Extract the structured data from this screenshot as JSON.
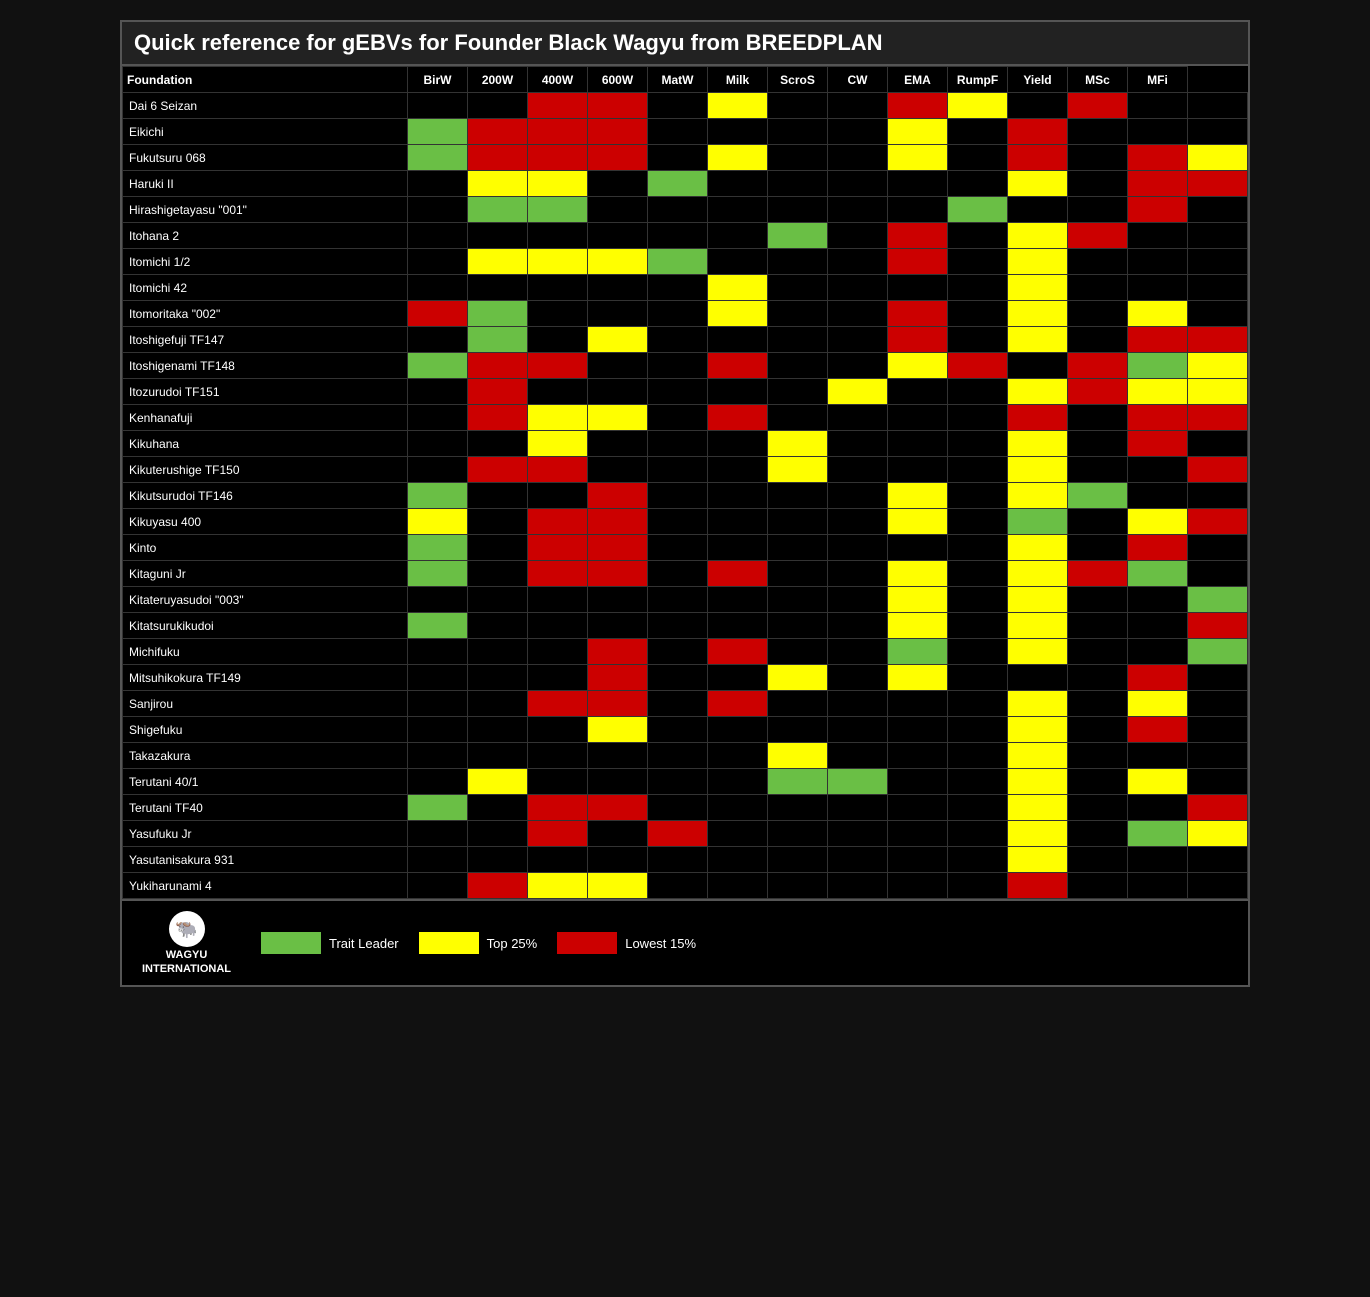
{
  "title": "Quick reference for gEBVs for Founder Black Wagyu from BREEDPLAN",
  "columns": [
    "Foundation",
    "BirW",
    "200W",
    "400W",
    "600W",
    "MatW",
    "Milk",
    "ScroS",
    "CW",
    "EMA",
    "RumpF",
    "Yield",
    "MSc",
    "MFi"
  ],
  "rows": [
    {
      "name": "Dai 6 Seizan",
      "cells": [
        "B",
        "B",
        "R",
        "R",
        "B",
        "Y",
        "B",
        "B",
        "R",
        "Y",
        "B",
        "R",
        "B",
        "B"
      ]
    },
    {
      "name": "Eikichi",
      "cells": [
        "G",
        "R",
        "R",
        "R",
        "B",
        "B",
        "B",
        "B",
        "Y",
        "B",
        "R",
        "B",
        "B",
        "B"
      ]
    },
    {
      "name": "Fukutsuru 068",
      "cells": [
        "G",
        "R",
        "R",
        "R",
        "B",
        "Y",
        "B",
        "B",
        "Y",
        "B",
        "R",
        "B",
        "R",
        "Y"
      ]
    },
    {
      "name": "Haruki II",
      "cells": [
        "B",
        "Y",
        "Y",
        "B",
        "G",
        "B",
        "B",
        "B",
        "B",
        "B",
        "Y",
        "B",
        "R",
        "R"
      ]
    },
    {
      "name": "Hirashigetayasu \"001\"",
      "cells": [
        "B",
        "G",
        "G",
        "B",
        "B",
        "B",
        "B",
        "B",
        "B",
        "G",
        "B",
        "B",
        "R",
        "B"
      ]
    },
    {
      "name": "Itohana 2",
      "cells": [
        "B",
        "B",
        "B",
        "B",
        "B",
        "B",
        "G",
        "B",
        "R",
        "B",
        "Y",
        "R",
        "B",
        "B"
      ]
    },
    {
      "name": "Itomichi 1/2",
      "cells": [
        "B",
        "Y",
        "Y",
        "Y",
        "G",
        "B",
        "B",
        "B",
        "R",
        "B",
        "Y",
        "B",
        "B",
        "B"
      ]
    },
    {
      "name": "Itomichi 42",
      "cells": [
        "B",
        "B",
        "B",
        "B",
        "B",
        "Y",
        "B",
        "B",
        "B",
        "B",
        "Y",
        "B",
        "B",
        "B"
      ]
    },
    {
      "name": "Itomoritaka \"002\"",
      "cells": [
        "R",
        "G",
        "B",
        "B",
        "B",
        "Y",
        "B",
        "B",
        "R",
        "B",
        "Y",
        "B",
        "Y",
        "B"
      ]
    },
    {
      "name": "Itoshigefuji TF147",
      "cells": [
        "B",
        "G",
        "B",
        "Y",
        "B",
        "B",
        "B",
        "B",
        "R",
        "B",
        "Y",
        "B",
        "R",
        "R"
      ]
    },
    {
      "name": "Itoshigenami TF148",
      "cells": [
        "G",
        "R",
        "R",
        "B",
        "B",
        "R",
        "B",
        "B",
        "Y",
        "R",
        "B",
        "R",
        "G",
        "Y"
      ]
    },
    {
      "name": "Itozurudoi TF151",
      "cells": [
        "B",
        "R",
        "B",
        "B",
        "B",
        "B",
        "B",
        "Y",
        "B",
        "B",
        "Y",
        "R",
        "Y",
        "Y"
      ]
    },
    {
      "name": "Kenhanafuji",
      "cells": [
        "B",
        "R",
        "Y",
        "Y",
        "B",
        "R",
        "B",
        "B",
        "B",
        "B",
        "R",
        "B",
        "R",
        "R"
      ]
    },
    {
      "name": "Kikuhana",
      "cells": [
        "B",
        "B",
        "Y",
        "B",
        "B",
        "B",
        "Y",
        "B",
        "B",
        "B",
        "Y",
        "B",
        "R",
        "B"
      ]
    },
    {
      "name": "Kikuterushige TF150",
      "cells": [
        "B",
        "R",
        "R",
        "B",
        "B",
        "B",
        "Y",
        "B",
        "B",
        "B",
        "Y",
        "B",
        "B",
        "R"
      ]
    },
    {
      "name": "Kikutsurudoi TF146",
      "cells": [
        "G",
        "B",
        "B",
        "R",
        "B",
        "B",
        "B",
        "B",
        "Y",
        "B",
        "Y",
        "G",
        "B",
        "B"
      ]
    },
    {
      "name": "Kikuyasu 400",
      "cells": [
        "Y",
        "B",
        "R",
        "R",
        "B",
        "B",
        "B",
        "B",
        "Y",
        "B",
        "G",
        "B",
        "Y",
        "R"
      ]
    },
    {
      "name": "Kinto",
      "cells": [
        "G",
        "B",
        "R",
        "R",
        "B",
        "B",
        "B",
        "B",
        "B",
        "B",
        "Y",
        "B",
        "R",
        "B"
      ]
    },
    {
      "name": "Kitaguni Jr",
      "cells": [
        "G",
        "B",
        "R",
        "R",
        "B",
        "R",
        "B",
        "B",
        "Y",
        "B",
        "Y",
        "R",
        "G",
        "B"
      ]
    },
    {
      "name": "Kitateruyasudoi \"003\"",
      "cells": [
        "B",
        "B",
        "B",
        "B",
        "B",
        "B",
        "B",
        "B",
        "Y",
        "B",
        "Y",
        "B",
        "B",
        "G"
      ]
    },
    {
      "name": "Kitatsurukikudoi",
      "cells": [
        "G",
        "B",
        "B",
        "B",
        "B",
        "B",
        "B",
        "B",
        "Y",
        "B",
        "Y",
        "B",
        "B",
        "R"
      ]
    },
    {
      "name": "Michifuku",
      "cells": [
        "B",
        "B",
        "B",
        "R",
        "B",
        "R",
        "B",
        "B",
        "G",
        "B",
        "Y",
        "B",
        "B",
        "G"
      ]
    },
    {
      "name": "Mitsuhikokura TF149",
      "cells": [
        "B",
        "B",
        "B",
        "R",
        "B",
        "B",
        "Y",
        "B",
        "Y",
        "B",
        "B",
        "B",
        "R",
        "B"
      ]
    },
    {
      "name": "Sanjirou",
      "cells": [
        "B",
        "B",
        "R",
        "R",
        "B",
        "R",
        "B",
        "B",
        "B",
        "B",
        "Y",
        "B",
        "Y",
        "B"
      ]
    },
    {
      "name": "Shigefuku",
      "cells": [
        "B",
        "B",
        "B",
        "Y",
        "B",
        "B",
        "B",
        "B",
        "B",
        "B",
        "Y",
        "B",
        "R",
        "B"
      ]
    },
    {
      "name": "Takazakura",
      "cells": [
        "B",
        "B",
        "B",
        "B",
        "B",
        "B",
        "Y",
        "B",
        "B",
        "B",
        "Y",
        "B",
        "B",
        "B"
      ]
    },
    {
      "name": "Terutani 40/1",
      "cells": [
        "B",
        "Y",
        "B",
        "B",
        "B",
        "B",
        "G",
        "G",
        "B",
        "B",
        "Y",
        "B",
        "Y",
        "B"
      ]
    },
    {
      "name": "Terutani TF40",
      "cells": [
        "G",
        "B",
        "R",
        "R",
        "B",
        "B",
        "B",
        "B",
        "B",
        "B",
        "Y",
        "B",
        "B",
        "R"
      ]
    },
    {
      "name": "Yasufuku Jr",
      "cells": [
        "B",
        "B",
        "R",
        "B",
        "R",
        "B",
        "B",
        "B",
        "B",
        "B",
        "Y",
        "B",
        "G",
        "Y"
      ]
    },
    {
      "name": "Yasutanisakura 931",
      "cells": [
        "B",
        "B",
        "B",
        "B",
        "B",
        "B",
        "B",
        "B",
        "B",
        "B",
        "Y",
        "B",
        "B",
        "B"
      ]
    },
    {
      "name": "Yukiharunami 4",
      "cells": [
        "B",
        "R",
        "Y",
        "Y",
        "B",
        "B",
        "B",
        "B",
        "B",
        "B",
        "R",
        "B",
        "B",
        "B"
      ]
    }
  ],
  "legend": {
    "trait_leader": "Trait Leader",
    "top_25": "Top 25%",
    "lowest_15": "Lowest 15%"
  },
  "logo": {
    "line1": "WAGYU",
    "line2": "INTERNATIONAL"
  }
}
